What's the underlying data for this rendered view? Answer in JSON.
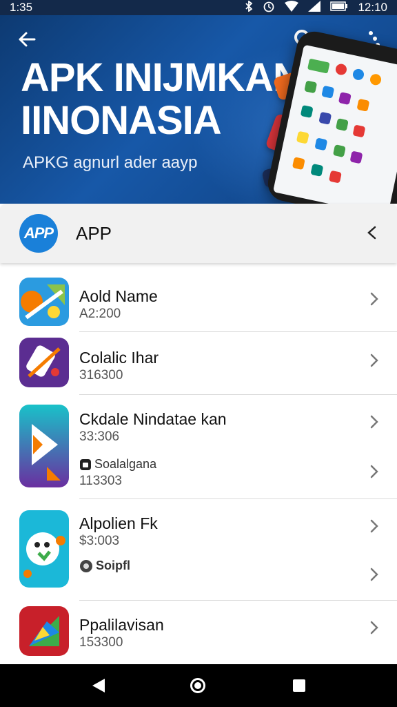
{
  "status_bar": {
    "time": "1:35",
    "right_text": "12:10",
    "icons": [
      "bluetooth-icon",
      "alarm-icon",
      "wifi-icon",
      "signal-icon",
      "battery-icon"
    ]
  },
  "hero": {
    "title_line1": "APK INIJMKAN",
    "title_line2": "IINONASIA",
    "subtitle": "APKG agnurl ader aayp"
  },
  "app_header": {
    "logo_text": "APP",
    "title": "APP"
  },
  "apps": [
    {
      "name": "Aold Name",
      "meta": "A2:200",
      "icon": "multicolor-tools-app-icon"
    },
    {
      "name": "Colalic Ihar",
      "meta": "316300",
      "icon": "purple-tools-app-icon"
    },
    {
      "name": "Ckdale Nindatae kan",
      "meta": "33:306",
      "extra_label": "Soalalgana",
      "extra_meta": "113303",
      "icon": "play-arrow-app-icon"
    },
    {
      "name": "Alpolien Fk",
      "meta": "$3:003",
      "extra_label": "Soipfl",
      "icon": "green-creature-app-icon"
    },
    {
      "name": "Ppalilavisan",
      "meta": "153300",
      "icon": "red-play-app-icon"
    }
  ],
  "colors": {
    "hero_bg": "#1758a8",
    "accent_blue": "#1a80d9",
    "status_bar": "#13294a"
  }
}
